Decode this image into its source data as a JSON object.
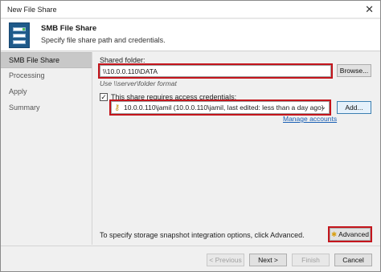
{
  "window": {
    "title": "New File Share",
    "close_glyph": "✕"
  },
  "header": {
    "title": "SMB File Share",
    "subtitle": "Specify file share path and credentials.",
    "icon": "server-icon"
  },
  "sidebar": {
    "items": [
      {
        "label": "SMB File Share",
        "active": true
      },
      {
        "label": "Processing",
        "active": false
      },
      {
        "label": "Apply",
        "active": false
      },
      {
        "label": "Summary",
        "active": false
      }
    ]
  },
  "form": {
    "shared_folder_label": "Shared folder:",
    "shared_folder_value": "\\\\10.0.0.110\\DATA",
    "browse_label": "Browse...",
    "use_format_hint": "Use \\\\server\\folder format",
    "requires_credentials_label": "This share requires access credentials:",
    "requires_credentials_checked": true,
    "check_glyph": "✓",
    "credentials_value": "10.0.0.110\\jamil (10.0.0.110\\jamil, last edited: less than a day ago)",
    "credentials_icon": "key-icon",
    "dropdown_glyph": "⌄",
    "add_label": "Add...",
    "manage_accounts_label": "Manage accounts",
    "snapshot_text": "To specify storage snapshot integration options, click Advanced.",
    "advanced_label": "Advanced"
  },
  "footer": {
    "previous_label": "< Previous",
    "next_label": "Next >",
    "finish_label": "Finish",
    "cancel_label": "Cancel"
  },
  "colors": {
    "highlight": "#c4151c",
    "link": "#1a5fb4",
    "active_step": "#c8c8c8"
  }
}
